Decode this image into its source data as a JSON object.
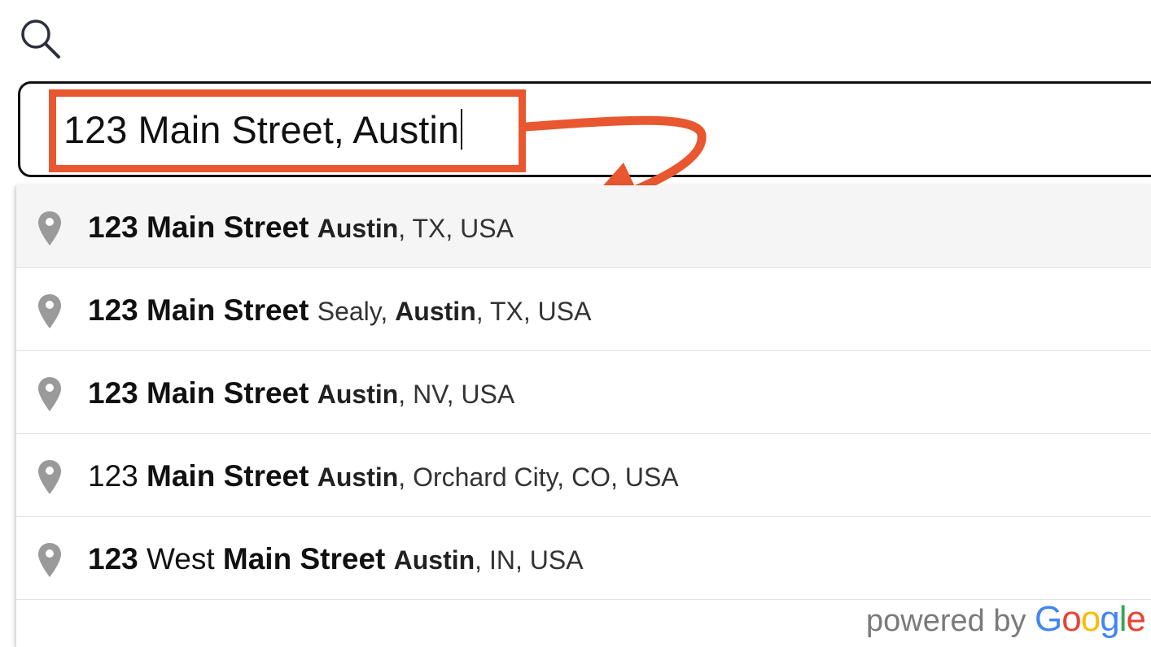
{
  "search": {
    "icon": "search-icon",
    "value": "123 Main Street, Austin"
  },
  "annotation": {
    "color": "#e8572f",
    "highlight_target": "search-input",
    "arrow_target": "suggestion-1"
  },
  "suggestions": [
    {
      "main_parts": [
        "123",
        " ",
        "Main Street"
      ],
      "secondary_parts": [
        "Austin",
        ", TX, USA"
      ]
    },
    {
      "main_parts": [
        "123",
        " ",
        "Main Street"
      ],
      "secondary_parts": [
        "Sealy, ",
        "Austin",
        ", TX, USA"
      ]
    },
    {
      "main_parts": [
        "123",
        " ",
        "Main Street"
      ],
      "secondary_parts": [
        "Austin",
        ", NV, USA"
      ]
    },
    {
      "main_parts": [
        "123",
        " ",
        "Main Street"
      ],
      "secondary_parts": [
        "Austin",
        ", Orchard City, CO, USA"
      ]
    },
    {
      "main_parts": [
        "123",
        " West ",
        "Main Street"
      ],
      "secondary_parts": [
        "Austin",
        ", IN, USA"
      ]
    }
  ],
  "footer": {
    "powered_by": "powered by ",
    "brand": [
      "G",
      "o",
      "o",
      "g",
      "l",
      "e"
    ],
    "brand_colors": [
      "#4285F4",
      "#EA4335",
      "#FBBC05",
      "#4285F4",
      "#34A853",
      "#EA4335"
    ]
  }
}
